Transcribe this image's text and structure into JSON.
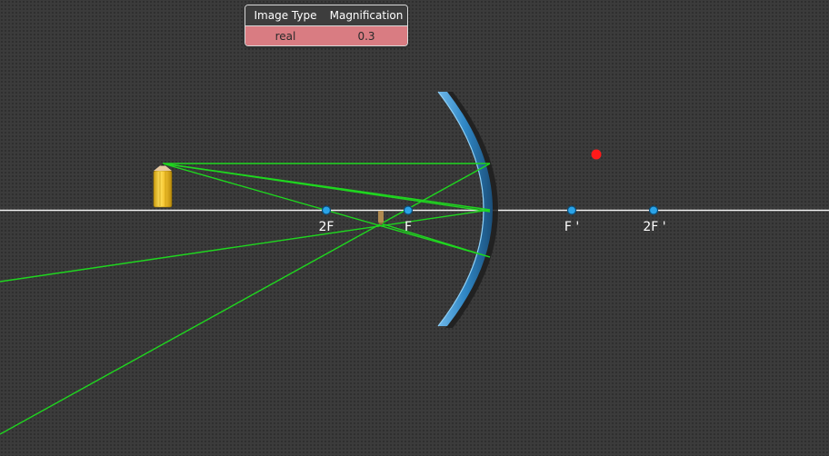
{
  "info_table": {
    "headers": [
      "Image Type",
      "Magnification"
    ],
    "values": [
      "real",
      "0.3"
    ]
  },
  "axis_labels": {
    "two_f_left": "2F",
    "f_left": "F",
    "f_right": "F '",
    "two_f_right": "2F '"
  },
  "colors": {
    "background": "#3b3b3b",
    "axis": "#ffffff",
    "ray": "#1fd61f",
    "mirror": "#2f86c4",
    "focal_point": "#2aa3e8",
    "object": "#f4c430",
    "image": "#b08a50",
    "marker": "#ff1a1a",
    "table_row": "#d97c82"
  },
  "icons": {
    "object": "pencil-object-icon",
    "image": "pencil-image-icon",
    "mirror": "concave-mirror-icon"
  }
}
